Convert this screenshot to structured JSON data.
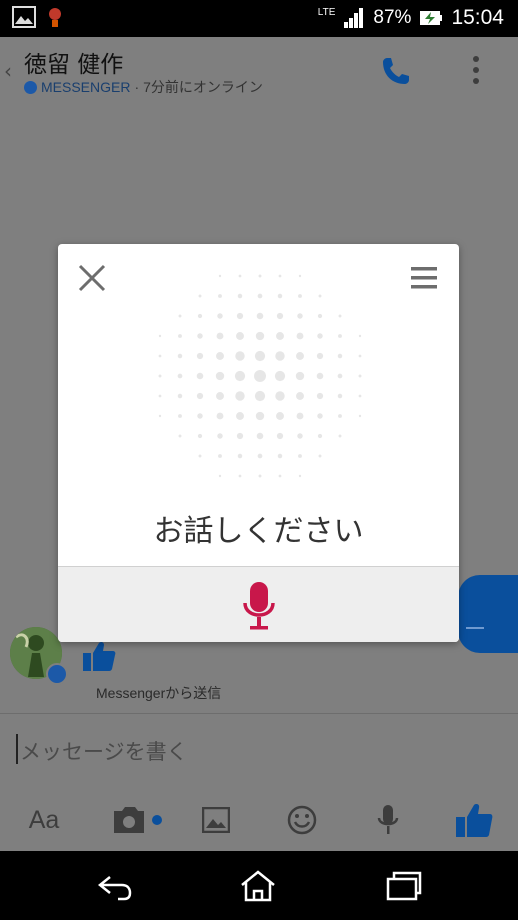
{
  "status_bar": {
    "network": "LTE",
    "battery": "87%",
    "time": "15:04"
  },
  "header": {
    "contact_name": "徳留 健作",
    "app_label": "MESSENGER",
    "separator": " · ",
    "online_status": "7分前にオンライン"
  },
  "chat": {
    "sent_via": "Messengerから送信"
  },
  "composer": {
    "placeholder": "メッセージを書く",
    "toolbar": [
      {
        "name": "text-format",
        "label": "Aa"
      },
      {
        "name": "camera",
        "icon": "camera-icon"
      },
      {
        "name": "gallery",
        "icon": "image-icon"
      },
      {
        "name": "emoji",
        "icon": "smiley-icon"
      },
      {
        "name": "voice",
        "icon": "microphone-icon"
      },
      {
        "name": "like",
        "icon": "thumbs-up-icon"
      }
    ]
  },
  "voice_dialog": {
    "prompt": "お話しください"
  },
  "colors": {
    "brand_blue": "#0a4f9c",
    "mic_red": "#c8174a",
    "overlay_gray": "#7f7f7f"
  }
}
